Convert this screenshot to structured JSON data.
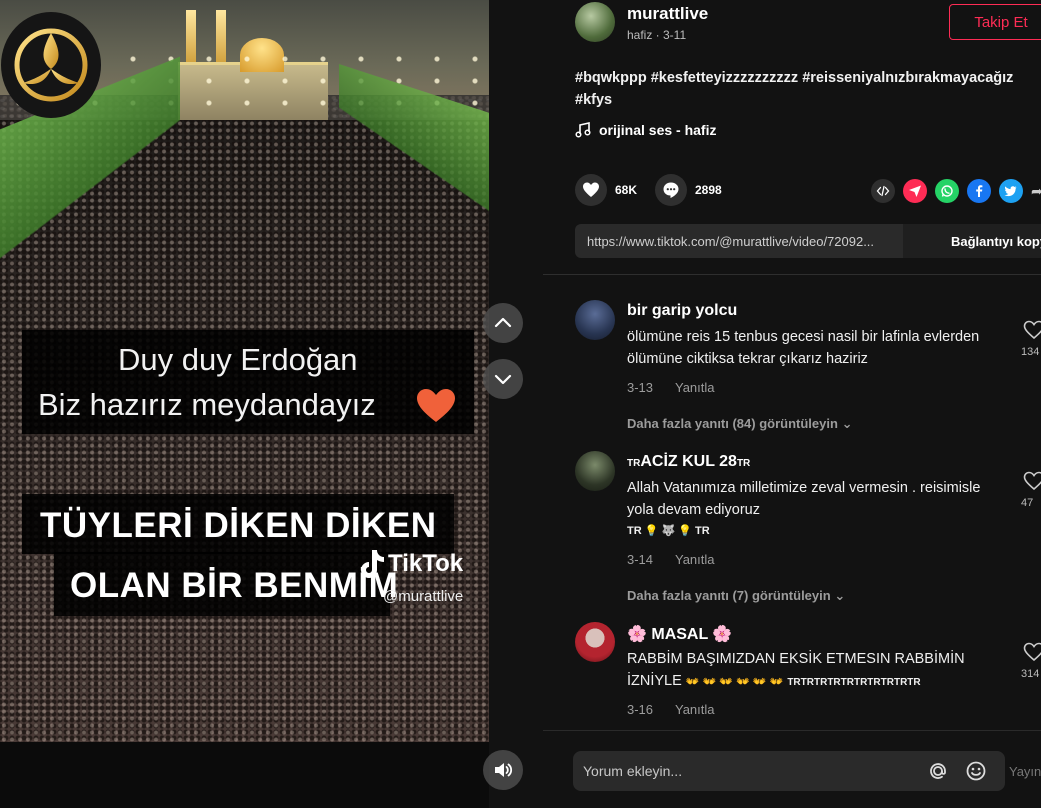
{
  "video": {
    "caption_line1": "Duy duy Erdoğan",
    "caption_line2": "Biz hazırız meydandayız",
    "caption_line3": "TÜYLERİ DİKEN DİKEN",
    "caption_line4": "OLAN BİR BENMİM",
    "watermark_brand": "TikTok",
    "watermark_user": "@murattlive"
  },
  "author": {
    "username": "murattlive",
    "meta": "hafiz · 3-11",
    "follow_label": "Takip Et"
  },
  "post": {
    "description": "#bqwkppp #kesfetteyizzzzzzzzzz #reisseniyalnızbırakmayacağız #kfys",
    "music": "orijinal ses - hafiz",
    "likes": "68K",
    "comments": "2898",
    "link_url": "https://www.tiktok.com/@murattlive/video/72092...",
    "copy_label": "Bağlantıyı kopyala"
  },
  "comments": [
    {
      "name": "bir garip yolcu",
      "text": "ölümüne reis 15 tenbus gecesi nasil bir lafinla evlerden ölümüne ciktiksa tekrar çıkarız haziriz",
      "date": "3-13",
      "reply": "Yanıtla",
      "more": "Daha fazla yanıtı (84) görüntüleyin",
      "likes": "134"
    },
    {
      "name_prefix": "TR",
      "name": "ACİZ KUL 28",
      "name_suffix": "TR",
      "text": "Allah Vatanımıza milletimize zeval vermesin . reisimisle yola devam ediyoruz",
      "extra": "TR 💡 🐺 💡 TR",
      "date": "3-14",
      "reply": "Yanıtla",
      "more": "Daha fazla yanıtı (7) görüntüleyin",
      "likes": "47"
    },
    {
      "name": "🌸 MASAL 🌸",
      "text": "RABBİM BAŞIMIZDAN EKSİK ETMESIN RABBİMİN İZNİYLE",
      "extra": "👐 👐 👐 👐 👐 👐",
      "extra_tr": "TRTRTRTRTRTRTRTRTRTR",
      "date": "3-16",
      "reply": "Yanıtla",
      "likes": "314"
    }
  ],
  "input": {
    "placeholder": "Yorum ekleyin...",
    "post_label": "Yayınla"
  },
  "colors": {
    "accent": "#fe2c55",
    "background": "#121212",
    "muted": "#9c9c9c"
  }
}
